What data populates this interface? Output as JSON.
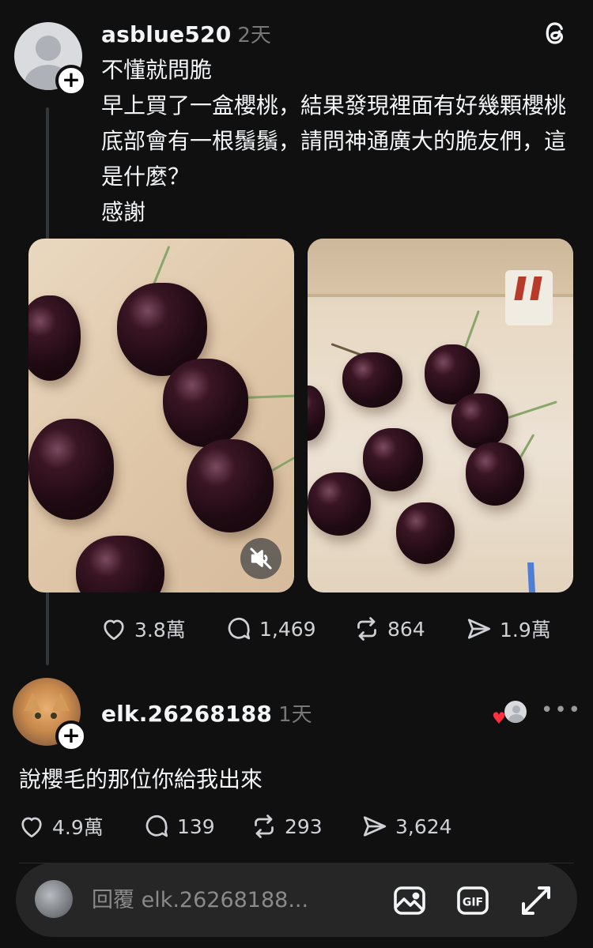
{
  "post": {
    "username": "asblue520",
    "time": "2天",
    "lines": [
      "不懂就問脆",
      "早上買了一盒櫻桃，結果發現裡面有好幾顆櫻桃底部會有一根鬚鬚，請問神通廣大的脆友們，這是什麼？",
      "感謝"
    ],
    "stats": {
      "likes": "3.8萬",
      "comments": "1,469",
      "reposts": "864",
      "shares": "1.9萬"
    }
  },
  "reply": {
    "username": "elk.26268188",
    "time": "1天",
    "text": "說櫻毛的那位你給我出來",
    "stats": {
      "likes": "4.9萬",
      "comments": "139",
      "reposts": "293",
      "shares": "3,624"
    }
  },
  "composer": {
    "placeholder": "回覆 elk.26268188..."
  },
  "icons": {
    "threads": "threads-logo-icon",
    "like": "heart-icon",
    "comment": "comment-icon",
    "repost": "repost-icon",
    "share": "share-icon",
    "image": "image-icon",
    "gif": "gif-icon",
    "expand": "expand-icon",
    "mute": "muted-speaker-icon",
    "more": "more-icon"
  },
  "colors": {
    "background": "#101010",
    "text": "#f3f5f7",
    "muted": "#777777",
    "like_red": "#ff3040"
  }
}
